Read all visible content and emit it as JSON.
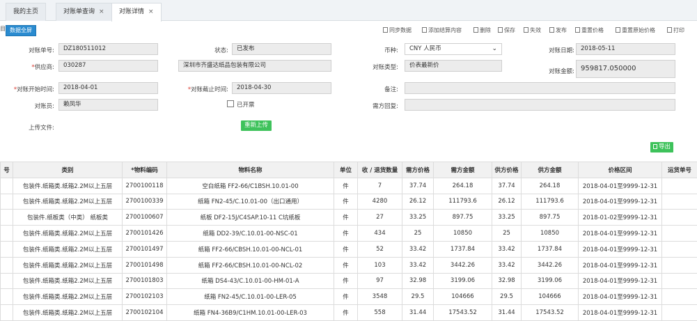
{
  "tabs": [
    {
      "label": "我的主页",
      "close": ""
    },
    {
      "label": "对账单查询",
      "close": "×"
    },
    {
      "label": "对账详情",
      "close": "×"
    }
  ],
  "left_edge": "目",
  "toolbar": {
    "fullscreen": "数据全屏",
    "buttons": [
      "同步数据",
      "添加结算内容",
      "删除",
      "保存",
      "失效",
      "发布",
      "重置价格",
      "重置原始价格",
      "打印"
    ]
  },
  "form": {
    "statement_no": {
      "label": "对账单号:",
      "value": "DZ180511012"
    },
    "status": {
      "label": "状态:",
      "value": "已发布"
    },
    "currency": {
      "label": "币种:",
      "value": "CNY 人民币",
      "arrow": "⌄"
    },
    "statement_date": {
      "label": "对账日期:",
      "value": "2018-05-11"
    },
    "supplier": {
      "label_req": "*",
      "label": "供应商:",
      "code": "030287",
      "name": "深圳市齐盛达纸品包装有限公司"
    },
    "statement_type": {
      "label": "对账类型:",
      "value": "价表最新价"
    },
    "amount": {
      "label": "对账金额:",
      "value": "959817.050000"
    },
    "start_time": {
      "label_req": "*",
      "label": "对账开始时间:",
      "value": "2018-04-01"
    },
    "end_time": {
      "label_req": "*",
      "label": "对账截止时间:",
      "value": "2018-04-30"
    },
    "remark": {
      "label": "备注:",
      "value": ""
    },
    "clerk": {
      "label": "对账员:",
      "value": "赖凤华"
    },
    "invoiced": {
      "label": "已开票"
    },
    "supplier_reply": {
      "label": "需方回复:",
      "value": ""
    },
    "upload": {
      "label": "上传文件:",
      "button": "重新上传"
    }
  },
  "export_label": "导出",
  "table": {
    "headers": [
      "号",
      "类别",
      "*物料编码",
      "物料名称",
      "单位",
      "收 / 退货数量",
      "需方价格",
      "需方金额",
      "供方价格",
      "供方金额",
      "价格区间",
      "运货单号"
    ],
    "rows": [
      [
        "",
        "包装件.纸箱类.纸箱2.2M以上五层",
        "2700100118",
        "空白纸箱 FF2-66/C1BSH.10.01-00",
        "件",
        "7",
        "37.74",
        "264.18",
        "37.74",
        "264.18",
        "2018-04-01至9999-12-31",
        ""
      ],
      [
        "",
        "包装件.纸箱类.纸箱2.2M以上五层",
        "2700100339",
        "纸箱 FN2-45/C.10.01-00（出口通用）",
        "件",
        "4280",
        "26.12",
        "111793.6",
        "26.12",
        "111793.6",
        "2018-04-01至9999-12-31",
        ""
      ],
      [
        "",
        "包装件.纸板类（中类） 纸板类",
        "2700100607",
        "纸板 DF2-15J/C4SAP.10-11 C坑纸板",
        "件",
        "27",
        "33.25",
        "897.75",
        "33.25",
        "897.75",
        "2018-01-02至9999-12-31",
        ""
      ],
      [
        "",
        "包装件.纸箱类.纸箱2.2M以上五层",
        "2700101426",
        "纸箱 DD2-39/C.10.01-00-NSC-01",
        "件",
        "434",
        "25",
        "10850",
        "25",
        "10850",
        "2018-04-01至9999-12-31",
        ""
      ],
      [
        "",
        "包装件.纸箱类.纸箱2.2M以上五层",
        "2700101497",
        "纸箱 FF2-66/CBSH.10.01-00-NCL-01",
        "件",
        "52",
        "33.42",
        "1737.84",
        "33.42",
        "1737.84",
        "2018-04-01至9999-12-31",
        ""
      ],
      [
        "",
        "包装件.纸箱类.纸箱2.2M以上五层",
        "2700101498",
        "纸箱 FF2-66/CBSH.10.01-00-NCL-02",
        "件",
        "103",
        "33.42",
        "3442.26",
        "33.42",
        "3442.26",
        "2018-04-01至9999-12-31",
        ""
      ],
      [
        "",
        "包装件.纸箱类.纸箱2.2M以上五层",
        "2700101803",
        "纸箱 DS4-43/C.10.01-00-HM-01-A",
        "件",
        "97",
        "32.98",
        "3199.06",
        "32.98",
        "3199.06",
        "2018-04-01至9999-12-31",
        ""
      ],
      [
        "",
        "包装件.纸箱类.纸箱2.2M以上五层",
        "2700102103",
        "纸箱 FN2-45/C.10.01-00-LER-05",
        "件",
        "3548",
        "29.5",
        "104666",
        "29.5",
        "104666",
        "2018-04-01至9999-12-31",
        ""
      ],
      [
        "",
        "包装件.纸箱类.纸箱2.2M以上五层",
        "2700102104",
        "纸箱 FN4-36B9/C1HM.10.01-00-LER-03",
        "件",
        "558",
        "31.44",
        "17543.52",
        "31.44",
        "17543.52",
        "2018-04-01至9999-12-31",
        ""
      ]
    ]
  }
}
